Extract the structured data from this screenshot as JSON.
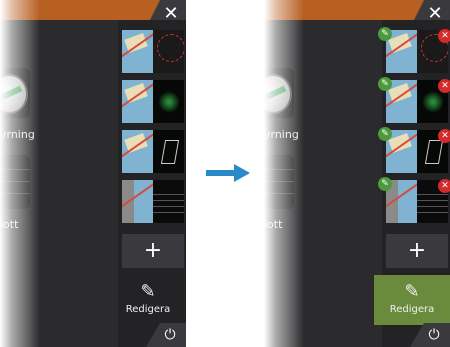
{
  "before": {
    "close_label": "✕",
    "labels": {
      "steering": "yrning",
      "plotter": "lott"
    },
    "tiles": [
      {
        "name": "chart-compass"
      },
      {
        "name": "chart-sonar"
      },
      {
        "name": "chart-navigation"
      },
      {
        "name": "chart-plotter"
      }
    ],
    "add_label": "+",
    "edit_label": "Redigera",
    "power_label": "⏻",
    "edit_active": false
  },
  "after": {
    "close_label": "✕",
    "labels": {
      "steering": "yrning",
      "plotter": "lott"
    },
    "tiles": [
      {
        "name": "chart-compass"
      },
      {
        "name": "chart-sonar"
      },
      {
        "name": "chart-navigation"
      },
      {
        "name": "chart-plotter"
      }
    ],
    "badge_wrench": "✎",
    "badge_remove": "✕",
    "add_label": "+",
    "edit_label": "Redigera",
    "power_label": "⏻",
    "edit_active": true
  },
  "colors": {
    "panel_bg": "#2b2b2d",
    "top_accent": "#b85f22",
    "edit_active": "#6a8a3c",
    "badge_wrench": "#4c9a3e",
    "badge_remove": "#d42a2a",
    "arrow": "#2a8ac9"
  },
  "icons": {
    "close": "close-icon",
    "add": "plus-icon",
    "edit": "pencil-icon",
    "power": "power-icon",
    "arrow": "arrow-right-icon"
  }
}
